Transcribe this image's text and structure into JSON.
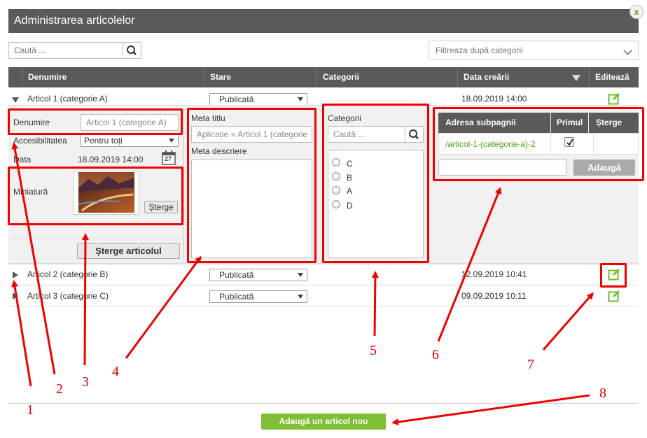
{
  "header": {
    "title": "Administrarea articolelor",
    "close_label": "x"
  },
  "toolbar": {
    "search_placeholder": "Caută ...",
    "filter_placeholder": "Filtreaza după categorii"
  },
  "columns": {
    "name": "Denumire",
    "status": "Stare",
    "categories": "Categorii",
    "date": "Data creării",
    "edit": "Editează"
  },
  "articles": [
    {
      "name": "Articol 1 (categorie A)",
      "status": "Publicată",
      "date": "18.09.2019 14:00"
    },
    {
      "name": "Articol 2 (categorie B)",
      "status": "Publicată",
      "date": "12.09.2019 10:41"
    },
    {
      "name": "Articol 3 (categorie C)",
      "status": "Publicată",
      "date": "09.09.2019 10:11"
    }
  ],
  "detail": {
    "name_label": "Denumire",
    "name_placeholder": "Articol 1 (categorie A)",
    "access_label": "Accesibilitatea",
    "access_value": "Pentru toți",
    "date_label": "Data",
    "date_value": "18.09.2019 14:00",
    "calendar_day": "27",
    "thumb_label": "Miniatură",
    "thumb_delete": "Șterge",
    "delete_article": "Șterge articolul",
    "meta_title_label": "Meta titlu",
    "meta_title_value": "Aplicație » Articol 1 (categorie",
    "meta_desc_label": "Meta descriere",
    "categories_label": "Categorii",
    "categories_search_placeholder": "Caută ...",
    "categories": [
      "C",
      "B",
      "A",
      "D"
    ],
    "subpage": {
      "col_address": "Adresa subpagnii",
      "col_primary": "Primul",
      "col_delete": "Șterge",
      "address": "/articol-1-(categorie-a)-2",
      "add_button": "Adaugă"
    }
  },
  "add_article_button": "Adaugă un articol nou",
  "callouts": [
    "1",
    "2",
    "3",
    "4",
    "5",
    "6",
    "7",
    "8"
  ],
  "colors": {
    "header": "#5a5a5a",
    "green": "#7fbf36",
    "callout": "#e00000"
  }
}
